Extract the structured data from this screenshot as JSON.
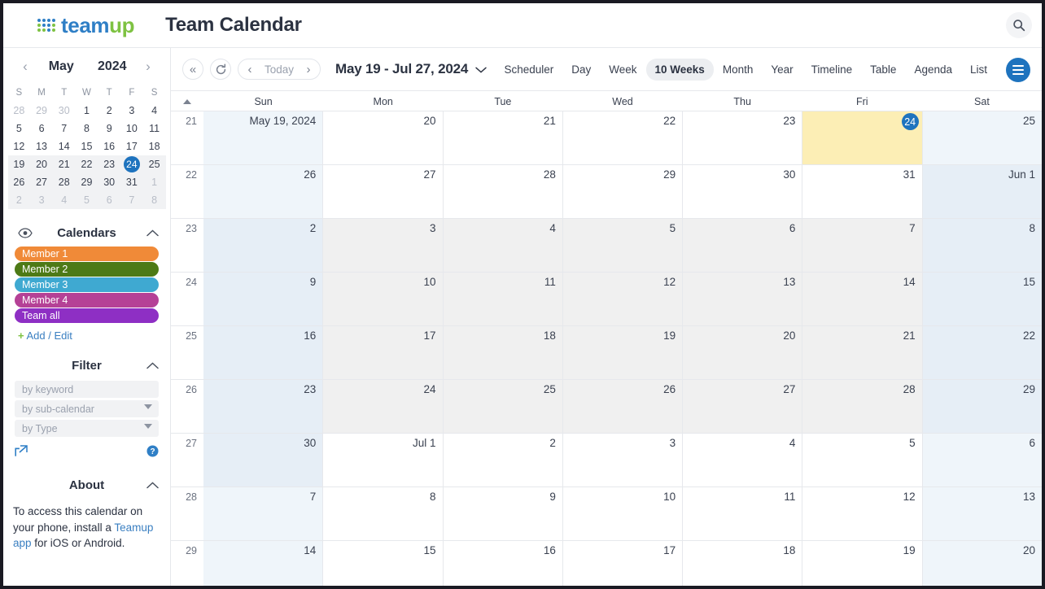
{
  "app": {
    "logo_team": "team",
    "logo_up": "up",
    "title": "Team Calendar",
    "search_icon": "search-icon"
  },
  "sidebar": {
    "mini_calendar": {
      "prev_label": "‹",
      "next_label": "›",
      "month": "May",
      "year": "2024",
      "dow": [
        "S",
        "M",
        "T",
        "W",
        "T",
        "F",
        "S"
      ],
      "today": 24,
      "weeks": [
        {
          "highlight": false,
          "days": [
            {
              "n": "28",
              "muted": true
            },
            {
              "n": "29",
              "muted": true
            },
            {
              "n": "30",
              "muted": true
            },
            {
              "n": "1",
              "muted": false
            },
            {
              "n": "2",
              "muted": false
            },
            {
              "n": "3",
              "muted": false
            },
            {
              "n": "4",
              "muted": false
            }
          ]
        },
        {
          "highlight": false,
          "days": [
            {
              "n": "5",
              "muted": false
            },
            {
              "n": "6",
              "muted": false
            },
            {
              "n": "7",
              "muted": false
            },
            {
              "n": "8",
              "muted": false
            },
            {
              "n": "9",
              "muted": false
            },
            {
              "n": "10",
              "muted": false
            },
            {
              "n": "11",
              "muted": false
            }
          ]
        },
        {
          "highlight": false,
          "days": [
            {
              "n": "12",
              "muted": false
            },
            {
              "n": "13",
              "muted": false
            },
            {
              "n": "14",
              "muted": false
            },
            {
              "n": "15",
              "muted": false
            },
            {
              "n": "16",
              "muted": false
            },
            {
              "n": "17",
              "muted": false
            },
            {
              "n": "18",
              "muted": false
            }
          ]
        },
        {
          "highlight": true,
          "days": [
            {
              "n": "19",
              "muted": false
            },
            {
              "n": "20",
              "muted": false
            },
            {
              "n": "21",
              "muted": false
            },
            {
              "n": "22",
              "muted": false
            },
            {
              "n": "23",
              "muted": false
            },
            {
              "n": "24",
              "muted": false,
              "today": true
            },
            {
              "n": "25",
              "muted": false
            }
          ]
        },
        {
          "highlight": true,
          "days": [
            {
              "n": "26",
              "muted": false
            },
            {
              "n": "27",
              "muted": false
            },
            {
              "n": "28",
              "muted": false
            },
            {
              "n": "29",
              "muted": false
            },
            {
              "n": "30",
              "muted": false
            },
            {
              "n": "31",
              "muted": false
            },
            {
              "n": "1",
              "muted": true
            }
          ]
        },
        {
          "highlight": true,
          "days": [
            {
              "n": "2",
              "muted": true
            },
            {
              "n": "3",
              "muted": true
            },
            {
              "n": "4",
              "muted": true
            },
            {
              "n": "5",
              "muted": true
            },
            {
              "n": "6",
              "muted": true
            },
            {
              "n": "7",
              "muted": true
            },
            {
              "n": "8",
              "muted": true
            }
          ]
        }
      ]
    },
    "calendars": {
      "section_title": "Calendars",
      "eye_icon": "eye-icon",
      "collapse_icon": "chevron-up-icon",
      "items": [
        {
          "label": "Member 1",
          "color": "#f08a38"
        },
        {
          "label": "Member 2",
          "color": "#4d7a16"
        },
        {
          "label": "Member 3",
          "color": "#3fa9d1"
        },
        {
          "label": "Member 4",
          "color": "#b54196"
        },
        {
          "label": "Team all",
          "color": "#8e2fc4"
        }
      ],
      "add_edit_plus": "+",
      "add_edit_label": "Add / Edit"
    },
    "filter": {
      "section_title": "Filter",
      "collapse_icon": "chevron-up-icon",
      "keyword_placeholder": "by keyword",
      "subcalendar_placeholder": "by sub-calendar",
      "type_placeholder": "by Type",
      "share_icon": "share-icon",
      "help_icon": "help-icon"
    },
    "about": {
      "section_title": "About",
      "collapse_icon": "chevron-up-icon",
      "text_before": "To access this calendar on your phone, install a ",
      "link_label": "Teamup app",
      "text_after": " for iOS or Android."
    }
  },
  "toolbar": {
    "first_label": "«",
    "refresh_icon": "refresh-icon",
    "prev_label": "‹",
    "today_label": "Today",
    "next_label": "›",
    "range_label": "May 19 - Jul 27, 2024",
    "range_caret": "chevron-down-icon",
    "views": [
      {
        "label": "Scheduler",
        "active": false
      },
      {
        "label": "Day",
        "active": false
      },
      {
        "label": "Week",
        "active": false
      },
      {
        "label": "10 Weeks",
        "active": true
      },
      {
        "label": "Month",
        "active": false
      },
      {
        "label": "Year",
        "active": false
      },
      {
        "label": "Timeline",
        "active": false
      },
      {
        "label": "Table",
        "active": false
      },
      {
        "label": "Agenda",
        "active": false
      },
      {
        "label": "List",
        "active": false
      }
    ],
    "menu_icon": "hamburger-menu-icon"
  },
  "grid": {
    "sort_icon": "sort-ascending-icon",
    "day_headers": [
      "Sun",
      "Mon",
      "Tue",
      "Wed",
      "Thu",
      "Fri",
      "Sat"
    ],
    "rows": [
      {
        "week": "21",
        "alt": false,
        "days": [
          {
            "n": "May 19, 2024",
            "weekend": true
          },
          {
            "n": "20"
          },
          {
            "n": "21"
          },
          {
            "n": "22"
          },
          {
            "n": "23"
          },
          {
            "n": "24",
            "today": true
          },
          {
            "n": "25",
            "weekend": true
          }
        ]
      },
      {
        "week": "22",
        "alt": false,
        "days": [
          {
            "n": "26",
            "weekend": true
          },
          {
            "n": "27"
          },
          {
            "n": "28"
          },
          {
            "n": "29"
          },
          {
            "n": "30"
          },
          {
            "n": "31"
          },
          {
            "n": "Jun 1",
            "weekend": true,
            "alt": true
          }
        ]
      },
      {
        "week": "23",
        "alt": true,
        "days": [
          {
            "n": "2",
            "weekend": true,
            "alt": true
          },
          {
            "n": "3"
          },
          {
            "n": "4"
          },
          {
            "n": "5"
          },
          {
            "n": "6"
          },
          {
            "n": "7"
          },
          {
            "n": "8",
            "weekend": true,
            "alt": true
          }
        ]
      },
      {
        "week": "24",
        "alt": true,
        "days": [
          {
            "n": "9",
            "weekend": true,
            "alt": true
          },
          {
            "n": "10"
          },
          {
            "n": "11"
          },
          {
            "n": "12"
          },
          {
            "n": "13"
          },
          {
            "n": "14"
          },
          {
            "n": "15",
            "weekend": true,
            "alt": true
          }
        ]
      },
      {
        "week": "25",
        "alt": true,
        "days": [
          {
            "n": "16",
            "weekend": true,
            "alt": true
          },
          {
            "n": "17"
          },
          {
            "n": "18"
          },
          {
            "n": "19"
          },
          {
            "n": "20"
          },
          {
            "n": "21"
          },
          {
            "n": "22",
            "weekend": true,
            "alt": true
          }
        ]
      },
      {
        "week": "26",
        "alt": true,
        "days": [
          {
            "n": "23",
            "weekend": true,
            "alt": true
          },
          {
            "n": "24"
          },
          {
            "n": "25"
          },
          {
            "n": "26"
          },
          {
            "n": "27"
          },
          {
            "n": "28"
          },
          {
            "n": "29",
            "weekend": true,
            "alt": true
          }
        ]
      },
      {
        "week": "27",
        "alt": false,
        "days": [
          {
            "n": "30",
            "weekend": true,
            "alt": true
          },
          {
            "n": "Jul 1"
          },
          {
            "n": "2"
          },
          {
            "n": "3"
          },
          {
            "n": "4"
          },
          {
            "n": "5"
          },
          {
            "n": "6",
            "weekend": true
          }
        ]
      },
      {
        "week": "28",
        "alt": false,
        "days": [
          {
            "n": "7",
            "weekend": true
          },
          {
            "n": "8"
          },
          {
            "n": "9"
          },
          {
            "n": "10"
          },
          {
            "n": "11"
          },
          {
            "n": "12"
          },
          {
            "n": "13",
            "weekend": true
          }
        ]
      },
      {
        "week": "29",
        "alt": false,
        "days": [
          {
            "n": "14",
            "weekend": true
          },
          {
            "n": "15"
          },
          {
            "n": "16"
          },
          {
            "n": "17"
          },
          {
            "n": "18"
          },
          {
            "n": "19"
          },
          {
            "n": "20",
            "weekend": true
          }
        ]
      }
    ]
  },
  "colors": {
    "brand_blue": "#1e73be",
    "brand_green": "#7ec242",
    "today_bg": "#fceeb5",
    "weekend_bg": "#eff5fa"
  }
}
